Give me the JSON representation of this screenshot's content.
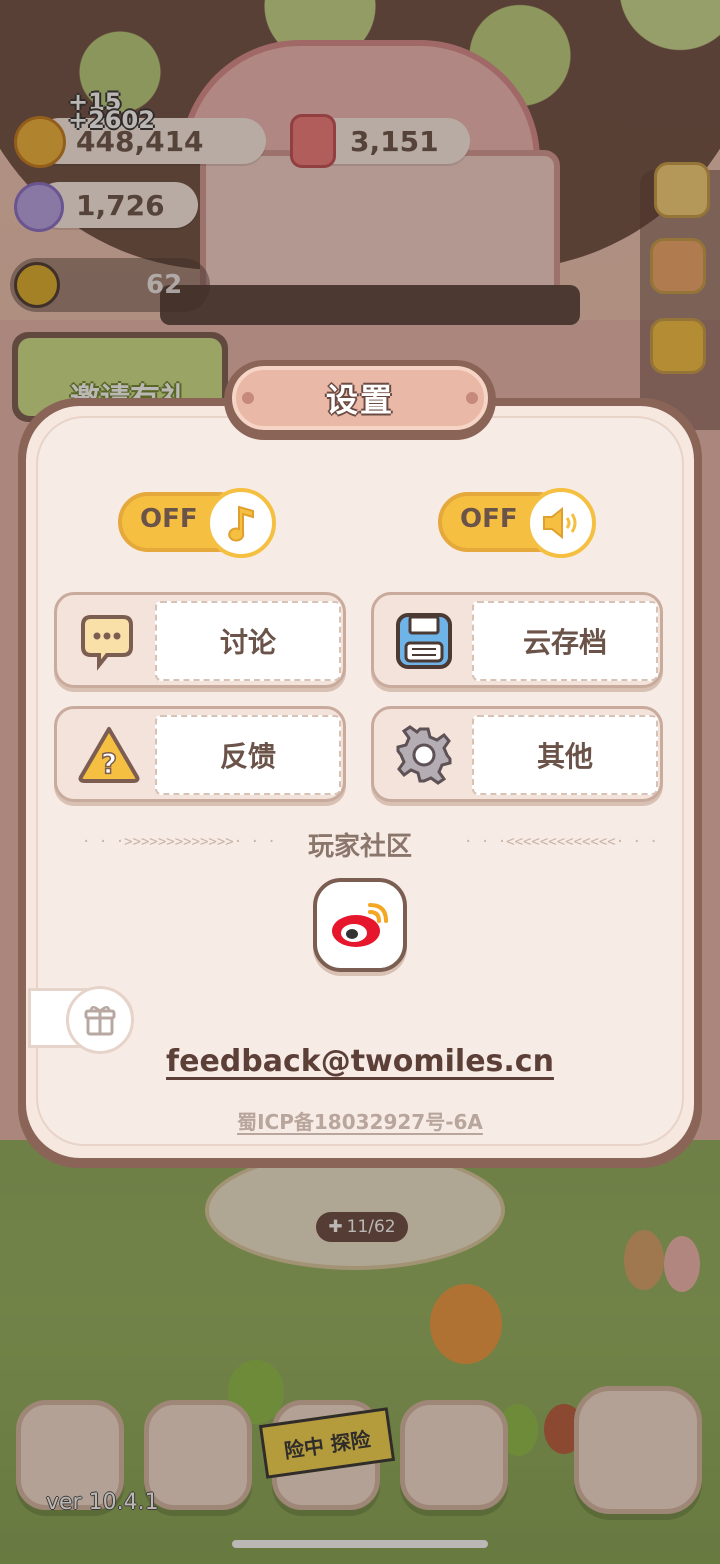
{
  "hud": {
    "coins": {
      "value": "448,414",
      "gain_1": "+15",
      "gain_2": "+2602"
    },
    "hearts": {
      "value": "3,151"
    },
    "crystals": {
      "value": "1,726"
    },
    "energy": {
      "value": "62"
    },
    "invite_banner_text": "邀请有礼"
  },
  "stage": {
    "counter": "11/62"
  },
  "settings": {
    "title": "设置",
    "music_toggle": {
      "state": "OFF",
      "icon": "music-note-icon"
    },
    "sound_toggle": {
      "state": "OFF",
      "icon": "speaker-icon"
    },
    "buttons": [
      {
        "label": "讨论",
        "icon": "chat-bubble-icon"
      },
      {
        "label": "云存档",
        "icon": "save-disk-icon"
      },
      {
        "label": "反馈",
        "icon": "question-icon"
      },
      {
        "label": "其他",
        "icon": "gear-icon"
      }
    ],
    "community_title": "玩家社区",
    "left_arrows": "· · ·>>>>>>>>>>>>>· · ·",
    "right_arrows": "· · ·<<<<<<<<<<<<<· · ·",
    "social": "weibo-icon",
    "email": "feedback@twomiles.cn",
    "icp": "蜀ICP备18032927号-6A"
  },
  "bottom_bar": {
    "version": "ver 10.4.1",
    "tape_text": "险中 探险"
  },
  "colors": {
    "panel_border": "#8b6458",
    "panel_bg": "#f7ebe5",
    "toggle_yellow": "#f5c041",
    "text_brown": "#6b5349"
  }
}
